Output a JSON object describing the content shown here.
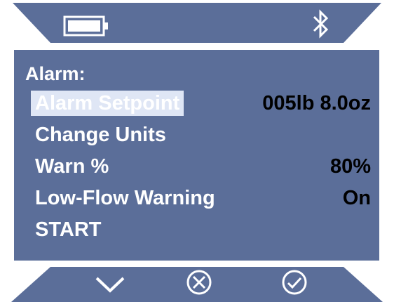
{
  "status_bar": {
    "battery_icon": "battery-icon",
    "bluetooth_icon": "bluetooth-icon"
  },
  "menu": {
    "title": "Alarm:",
    "items": [
      {
        "label": "Alarm Setpoint",
        "value": "005lb 8.0oz",
        "selected": true
      },
      {
        "label": "Change Units",
        "value": ""
      },
      {
        "label": "Warn %",
        "value": "80%"
      },
      {
        "label": "Low-Flow Warning",
        "value": "On"
      },
      {
        "label": "START",
        "value": ""
      }
    ]
  },
  "bottom_bar": {
    "down_icon": "chevron-down-icon",
    "cancel_icon": "cancel-circle-icon",
    "confirm_icon": "confirm-circle-icon"
  },
  "colors": {
    "panel": "#5b6e99",
    "highlight": "#dfe6f5",
    "text": "#ffffff",
    "value_text": "#000000"
  }
}
